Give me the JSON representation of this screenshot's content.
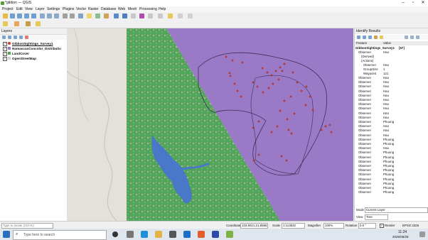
{
  "window": {
    "title": "*gibbon — QGIS"
  },
  "menu": [
    "Project",
    "Edit",
    "View",
    "Layer",
    "Settings",
    "Plugins",
    "Vector",
    "Raster",
    "Database",
    "Web",
    "Mesh",
    "Processing",
    "Help"
  ],
  "layers_panel": {
    "title": "Layers",
    "items": [
      {
        "label": "GibbonSightings_Survey1",
        "checked": true,
        "color": "#d63c2c"
      },
      {
        "label": "NomascusConcolor_Distributio",
        "checked": true,
        "color": "#9a79c6"
      },
      {
        "label": "LandCover",
        "checked": true,
        "color": "#4fa65a"
      },
      {
        "label": "OpenStreetMap",
        "checked": true,
        "color": "#cfcfcf"
      }
    ]
  },
  "identify_panel": {
    "title": "Identify Results",
    "col_feature": "Feature",
    "col_value": "Value",
    "layer_row": {
      "feature": "GibbonSightings_Survey1",
      "value": "[67]"
    },
    "expanded": {
      "feature": "Observer",
      "value": "Hao",
      "derived": "(Derived)",
      "actions": "(Actions)",
      "attributes": [
        {
          "name": "Observer",
          "value": "Hao"
        },
        {
          "name": "GroupSize",
          "value": "1"
        },
        {
          "name": "Waypoint",
          "value": "121"
        }
      ]
    },
    "rows": [
      {
        "feature": "Observer",
        "value": "Hao"
      },
      {
        "feature": "Observer",
        "value": "Hao"
      },
      {
        "feature": "Observer",
        "value": "Hao"
      },
      {
        "feature": "Observer",
        "value": "Hao"
      },
      {
        "feature": "Observer",
        "value": "Hao"
      },
      {
        "feature": "Observer",
        "value": "Hao"
      },
      {
        "feature": "Observer",
        "value": "Hao"
      },
      {
        "feature": "Observer",
        "value": "Hao"
      },
      {
        "feature": "Observer",
        "value": "Hao"
      },
      {
        "feature": "Observer",
        "value": "Hao"
      },
      {
        "feature": "Observer",
        "value": "Phuong"
      },
      {
        "feature": "Observer",
        "value": "Hao"
      },
      {
        "feature": "Observer",
        "value": "Hao"
      },
      {
        "feature": "Observer",
        "value": "Hao"
      },
      {
        "feature": "Observer",
        "value": "Phuong"
      },
      {
        "feature": "Observer",
        "value": "Phuong"
      },
      {
        "feature": "Observer",
        "value": "Hao"
      },
      {
        "feature": "Observer",
        "value": "Phuong"
      },
      {
        "feature": "Observer",
        "value": "Phuong"
      },
      {
        "feature": "Observer",
        "value": "Phuong"
      },
      {
        "feature": "Observer",
        "value": "Phuong"
      },
      {
        "feature": "Observer",
        "value": "Phuong"
      },
      {
        "feature": "Observer",
        "value": "Phuong"
      },
      {
        "feature": "Observer",
        "value": "Phuong"
      },
      {
        "feature": "Observer",
        "value": "Phuong"
      },
      {
        "feature": "Observer",
        "value": "Phuong"
      },
      {
        "feature": "Observer",
        "value": "Phuong"
      }
    ],
    "mode_label": "Mode",
    "mode_value": "Current Layer",
    "view_label": "View",
    "view_value": "Tree"
  },
  "statusbar": {
    "locate_placeholder": "Type to locate (Ctrl+K)",
    "coordinate_label": "Coordinate",
    "coordinate_value": "103.9021,21.8596",
    "scale_label": "Scale",
    "scale_value": "1:113832",
    "magnifier_label": "Magnifier",
    "magnifier_value": "100%",
    "rotation_label": "Rotation",
    "rotation_value": "0.0 °",
    "render_label": "Render",
    "crs": "EPSG:4326"
  },
  "taskbar": {
    "search_placeholder": "Type here to search",
    "time": "11:24",
    "date": "2025/06/28"
  },
  "colors": {
    "landcover": "#4fa65a",
    "distribution": "#9a79c6",
    "sightings": "#d63c2c",
    "water": "#4a78c8"
  }
}
